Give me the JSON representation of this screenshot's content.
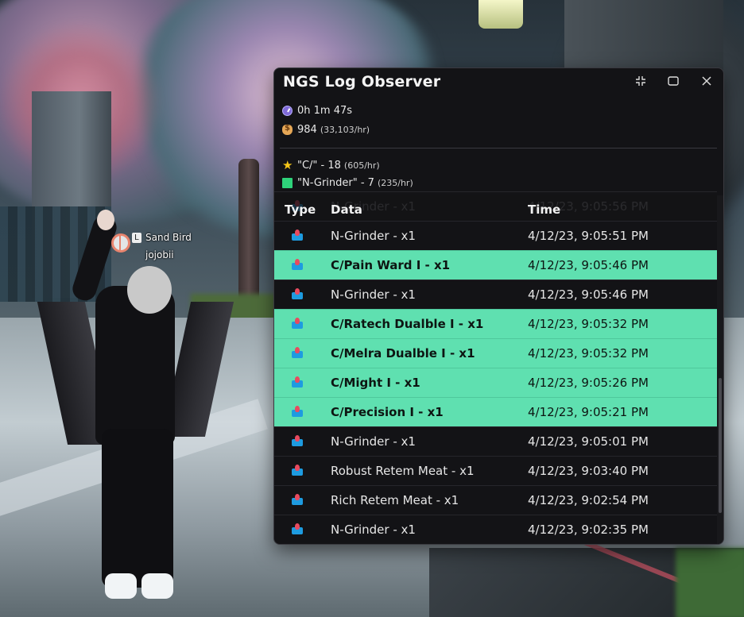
{
  "game": {
    "npc_name": "Sand Bird",
    "player_name": "jojobii",
    "key_hint": "L"
  },
  "window": {
    "title": "NGS Log Observer",
    "controls": {
      "minimize_icon": "collapse-arrows-icon",
      "maximize_icon": "square-icon",
      "close_icon": "x-icon"
    }
  },
  "stats": {
    "elapsed": {
      "icon": "clock-icon",
      "text": "0h 1m 47s"
    },
    "meseta": {
      "icon": "money-bag-icon",
      "value": "984",
      "rate": "(33,103/hr)"
    }
  },
  "tracked": [
    {
      "icon": "star-icon",
      "color": "#f5c518",
      "label": "\"C/\" - 18",
      "rate": "(605/hr)"
    },
    {
      "icon": "green-square-icon",
      "color": "#2ed27a",
      "label": "\"N-Grinder\" - 7",
      "rate": "(235/hr)"
    }
  ],
  "table": {
    "headers": {
      "type": "Type",
      "data": "Data",
      "time": "Time"
    },
    "highlight_color": "#5fe0b0",
    "rows": [
      {
        "data": "N-Grinder - x1",
        "time": "4/12/23, 9:05:56 PM",
        "highlight": false,
        "faded": true
      },
      {
        "data": "N-Grinder - x1",
        "time": "4/12/23, 9:05:51 PM",
        "highlight": false
      },
      {
        "data": "C/Pain Ward I - x1",
        "time": "4/12/23, 9:05:46 PM",
        "highlight": true
      },
      {
        "data": "N-Grinder - x1",
        "time": "4/12/23, 9:05:46 PM",
        "highlight": false
      },
      {
        "data": "C/Ratech Dualble I - x1",
        "time": "4/12/23, 9:05:32 PM",
        "highlight": true
      },
      {
        "data": "C/Melra Dualble I - x1",
        "time": "4/12/23, 9:05:32 PM",
        "highlight": true
      },
      {
        "data": "C/Might I - x1",
        "time": "4/12/23, 9:05:26 PM",
        "highlight": true
      },
      {
        "data": "C/Precision I - x1",
        "time": "4/12/23, 9:05:21 PM",
        "highlight": true
      },
      {
        "data": "N-Grinder - x1",
        "time": "4/12/23, 9:05:01 PM",
        "highlight": false
      },
      {
        "data": "Robust Retem Meat - x1",
        "time": "4/12/23, 9:03:40 PM",
        "highlight": false
      },
      {
        "data": "Rich Retem Meat - x1",
        "time": "4/12/23, 9:02:54 PM",
        "highlight": false
      },
      {
        "data": "N-Grinder - x1",
        "time": "4/12/23, 9:02:35 PM",
        "highlight": false
      }
    ]
  }
}
